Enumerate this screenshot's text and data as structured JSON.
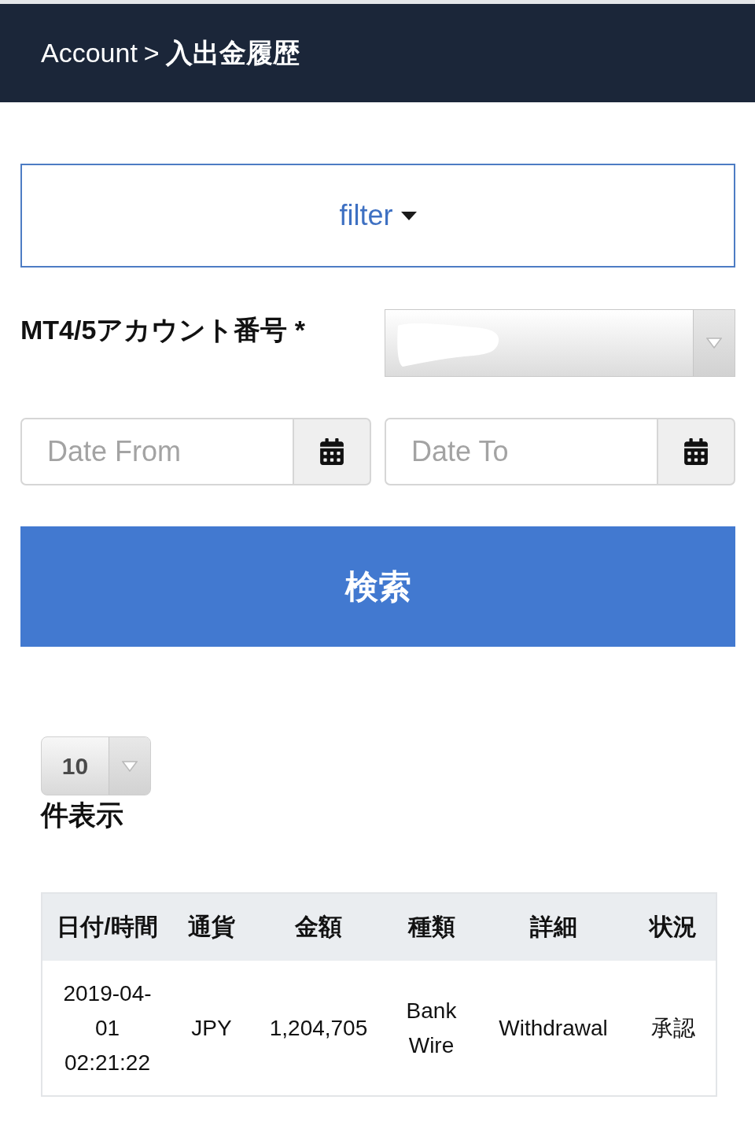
{
  "header": {
    "parent": "Account",
    "separator": ">",
    "current": "入出金履歴"
  },
  "filter_toggle": {
    "label": "filter"
  },
  "account_field": {
    "label": "MT4/5アカウント番号",
    "required_mark": "*"
  },
  "date_from": {
    "placeholder": "Date From"
  },
  "date_to": {
    "placeholder": "Date To"
  },
  "search_button": {
    "label": "検索"
  },
  "page_size": {
    "value": "10",
    "label": "件表示"
  },
  "table": {
    "columns": [
      "日付/時間",
      "通貨",
      "金額",
      "種類",
      "詳細",
      "状況"
    ],
    "rows": [
      [
        "2019-04-01 02:21:22",
        "JPY",
        "1,204,705",
        "Bank Wire",
        "Withdrawal",
        "承認"
      ]
    ]
  }
}
